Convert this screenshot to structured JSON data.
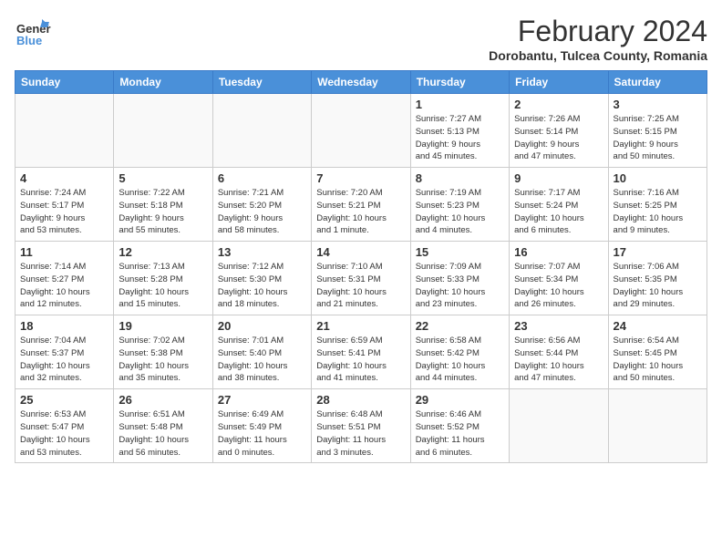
{
  "logo": {
    "general": "General",
    "blue": "Blue"
  },
  "title": "February 2024",
  "subtitle": "Dorobantu, Tulcea County, Romania",
  "days_of_week": [
    "Sunday",
    "Monday",
    "Tuesday",
    "Wednesday",
    "Thursday",
    "Friday",
    "Saturday"
  ],
  "weeks": [
    [
      {
        "day": "",
        "info": ""
      },
      {
        "day": "",
        "info": ""
      },
      {
        "day": "",
        "info": ""
      },
      {
        "day": "",
        "info": ""
      },
      {
        "day": "1",
        "info": "Sunrise: 7:27 AM\nSunset: 5:13 PM\nDaylight: 9 hours\nand 45 minutes."
      },
      {
        "day": "2",
        "info": "Sunrise: 7:26 AM\nSunset: 5:14 PM\nDaylight: 9 hours\nand 47 minutes."
      },
      {
        "day": "3",
        "info": "Sunrise: 7:25 AM\nSunset: 5:15 PM\nDaylight: 9 hours\nand 50 minutes."
      }
    ],
    [
      {
        "day": "4",
        "info": "Sunrise: 7:24 AM\nSunset: 5:17 PM\nDaylight: 9 hours\nand 53 minutes."
      },
      {
        "day": "5",
        "info": "Sunrise: 7:22 AM\nSunset: 5:18 PM\nDaylight: 9 hours\nand 55 minutes."
      },
      {
        "day": "6",
        "info": "Sunrise: 7:21 AM\nSunset: 5:20 PM\nDaylight: 9 hours\nand 58 minutes."
      },
      {
        "day": "7",
        "info": "Sunrise: 7:20 AM\nSunset: 5:21 PM\nDaylight: 10 hours\nand 1 minute."
      },
      {
        "day": "8",
        "info": "Sunrise: 7:19 AM\nSunset: 5:23 PM\nDaylight: 10 hours\nand 4 minutes."
      },
      {
        "day": "9",
        "info": "Sunrise: 7:17 AM\nSunset: 5:24 PM\nDaylight: 10 hours\nand 6 minutes."
      },
      {
        "day": "10",
        "info": "Sunrise: 7:16 AM\nSunset: 5:25 PM\nDaylight: 10 hours\nand 9 minutes."
      }
    ],
    [
      {
        "day": "11",
        "info": "Sunrise: 7:14 AM\nSunset: 5:27 PM\nDaylight: 10 hours\nand 12 minutes."
      },
      {
        "day": "12",
        "info": "Sunrise: 7:13 AM\nSunset: 5:28 PM\nDaylight: 10 hours\nand 15 minutes."
      },
      {
        "day": "13",
        "info": "Sunrise: 7:12 AM\nSunset: 5:30 PM\nDaylight: 10 hours\nand 18 minutes."
      },
      {
        "day": "14",
        "info": "Sunrise: 7:10 AM\nSunset: 5:31 PM\nDaylight: 10 hours\nand 21 minutes."
      },
      {
        "day": "15",
        "info": "Sunrise: 7:09 AM\nSunset: 5:33 PM\nDaylight: 10 hours\nand 23 minutes."
      },
      {
        "day": "16",
        "info": "Sunrise: 7:07 AM\nSunset: 5:34 PM\nDaylight: 10 hours\nand 26 minutes."
      },
      {
        "day": "17",
        "info": "Sunrise: 7:06 AM\nSunset: 5:35 PM\nDaylight: 10 hours\nand 29 minutes."
      }
    ],
    [
      {
        "day": "18",
        "info": "Sunrise: 7:04 AM\nSunset: 5:37 PM\nDaylight: 10 hours\nand 32 minutes."
      },
      {
        "day": "19",
        "info": "Sunrise: 7:02 AM\nSunset: 5:38 PM\nDaylight: 10 hours\nand 35 minutes."
      },
      {
        "day": "20",
        "info": "Sunrise: 7:01 AM\nSunset: 5:40 PM\nDaylight: 10 hours\nand 38 minutes."
      },
      {
        "day": "21",
        "info": "Sunrise: 6:59 AM\nSunset: 5:41 PM\nDaylight: 10 hours\nand 41 minutes."
      },
      {
        "day": "22",
        "info": "Sunrise: 6:58 AM\nSunset: 5:42 PM\nDaylight: 10 hours\nand 44 minutes."
      },
      {
        "day": "23",
        "info": "Sunrise: 6:56 AM\nSunset: 5:44 PM\nDaylight: 10 hours\nand 47 minutes."
      },
      {
        "day": "24",
        "info": "Sunrise: 6:54 AM\nSunset: 5:45 PM\nDaylight: 10 hours\nand 50 minutes."
      }
    ],
    [
      {
        "day": "25",
        "info": "Sunrise: 6:53 AM\nSunset: 5:47 PM\nDaylight: 10 hours\nand 53 minutes."
      },
      {
        "day": "26",
        "info": "Sunrise: 6:51 AM\nSunset: 5:48 PM\nDaylight: 10 hours\nand 56 minutes."
      },
      {
        "day": "27",
        "info": "Sunrise: 6:49 AM\nSunset: 5:49 PM\nDaylight: 11 hours\nand 0 minutes."
      },
      {
        "day": "28",
        "info": "Sunrise: 6:48 AM\nSunset: 5:51 PM\nDaylight: 11 hours\nand 3 minutes."
      },
      {
        "day": "29",
        "info": "Sunrise: 6:46 AM\nSunset: 5:52 PM\nDaylight: 11 hours\nand 6 minutes."
      },
      {
        "day": "",
        "info": ""
      },
      {
        "day": "",
        "info": ""
      }
    ]
  ]
}
